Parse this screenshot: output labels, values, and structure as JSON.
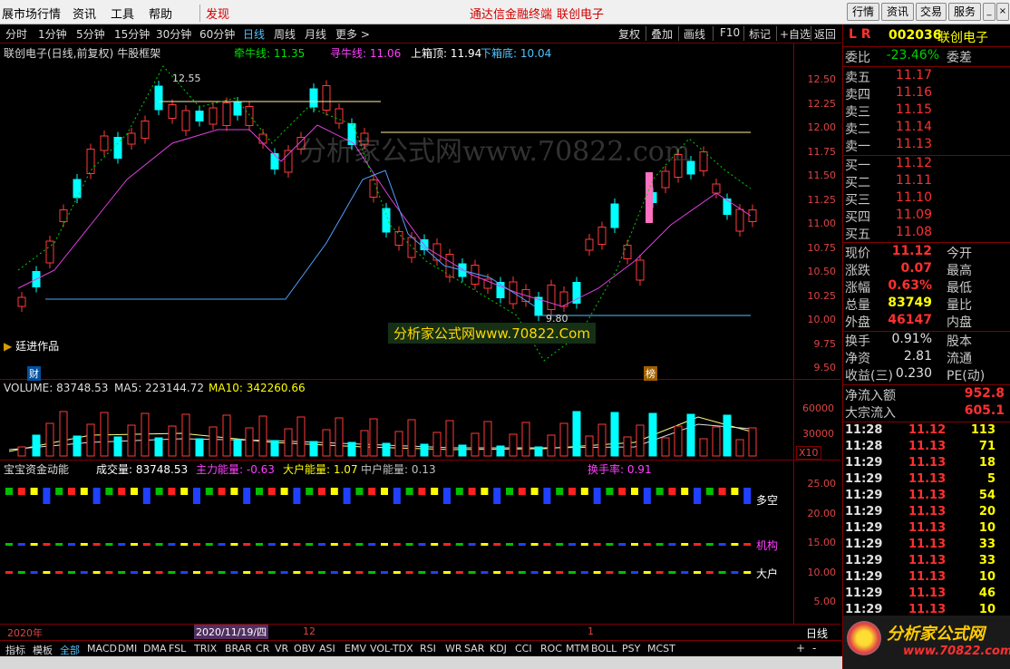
{
  "menu": {
    "items": [
      "展市场行情",
      "资讯",
      "工具",
      "帮助",
      "发现"
    ],
    "center_links": [
      "通达信金融终端",
      "联创电子"
    ],
    "right_buttons": [
      "行情",
      "资讯",
      "交易",
      "服务"
    ]
  },
  "periods": [
    "分时",
    "1分钟",
    "5分钟",
    "15分钟",
    "30分钟",
    "60分钟",
    "日线",
    "周线",
    "月线",
    "更多 >"
  ],
  "tools": [
    "复权",
    "叠加",
    "画线",
    "F10",
    "标记",
    "+自选",
    "返回"
  ],
  "main_chart": {
    "title": "联创电子(日线,前复权)",
    "indicator_name": "牛股框架",
    "lines": [
      {
        "label": "牵牛线: 11.35",
        "color": "#00e000"
      },
      {
        "label": "寻牛线: 11.06",
        "color": "#ff40ff"
      },
      {
        "label": "上箱顶: 11.94",
        "color": "#ffffff"
      },
      {
        "label": "下箱底: 10.04",
        "color": "#4fc3ff"
      }
    ],
    "yaxis": [
      "12.50",
      "12.25",
      "12.00",
      "11.75",
      "11.50",
      "11.25",
      "11.00",
      "10.75",
      "10.50",
      "10.25",
      "10.00",
      "9.75",
      "9.50"
    ],
    "high_label": "12.55",
    "low_label": "9.80",
    "author_label": "廷进作品",
    "watermark": "分析家公式网www.70822.com",
    "banner": "分析家公式网www.70822.Com",
    "markers": [
      "财",
      "榜"
    ]
  },
  "volume_chart": {
    "title": "VOLUME: 83748.53",
    "ma5": "MA5: 223144.72",
    "ma10": "MA10: 342260.66",
    "yaxis": [
      "60000",
      "30000"
    ],
    "unit": "X10"
  },
  "money_chart": {
    "title": "宝宝资金动能",
    "items": [
      {
        "label": "成交量: 83748.53",
        "color": "#ffffff"
      },
      {
        "label": "主力能量: -0.63",
        "color": "#ff40ff"
      },
      {
        "label": "大户能量: 1.07",
        "color": "#ffff00"
      },
      {
        "label": "中户能量: 0.13",
        "color": "#c0c0c0"
      },
      {
        "label": "换手率: 0.91",
        "color": "#ff40ff"
      }
    ],
    "yaxis": [
      "25.00",
      "20.00",
      "15.00",
      "10.00",
      "5.00"
    ],
    "row_labels": [
      "多空",
      "机构",
      "大户"
    ]
  },
  "time_axis": {
    "labels": [
      "2020年",
      "2020/11/19/四",
      "12",
      "1"
    ],
    "period_label": "日线"
  },
  "bottom_tabs": [
    "指标",
    "模板",
    "全部",
    "MACD",
    "DMI",
    "DMA",
    "FSL",
    "TRIX",
    "BRAR",
    "CR",
    "VR",
    "OBV",
    "ASI",
    "EMV",
    "VOL-TDX",
    "RSI",
    "WR",
    "SAR",
    "KDJ",
    "CCI",
    "ROC",
    "MTM",
    "BOLL",
    "PSY",
    "MCST"
  ],
  "stock": {
    "code": "002036",
    "name": "联创电子",
    "flags": "L R"
  },
  "order_book": {
    "ratio_label": "委比",
    "ratio": "-23.46%",
    "diff_label": "委差",
    "asks": [
      {
        "label": "卖五",
        "price": "11.17"
      },
      {
        "label": "卖四",
        "price": "11.16"
      },
      {
        "label": "卖三",
        "price": "11.15"
      },
      {
        "label": "卖二",
        "price": "11.14"
      },
      {
        "label": "卖一",
        "price": "11.13"
      }
    ],
    "bids": [
      {
        "label": "买一",
        "price": "11.12"
      },
      {
        "label": "买二",
        "price": "11.11"
      },
      {
        "label": "买三",
        "price": "11.10"
      },
      {
        "label": "买四",
        "price": "11.09"
      },
      {
        "label": "买五",
        "price": "11.08"
      }
    ]
  },
  "quote": [
    {
      "label": "现价",
      "value": "11.12",
      "label2": "今开",
      "color": "#ff3030"
    },
    {
      "label": "涨跌",
      "value": "0.07",
      "label2": "最高",
      "color": "#ff3030"
    },
    {
      "label": "涨幅",
      "value": "0.63%",
      "label2": "最低",
      "color": "#ff3030"
    },
    {
      "label": "总量",
      "value": "83749",
      "label2": "量比",
      "color": "#ffff00"
    },
    {
      "label": "外盘",
      "value": "46147",
      "label2": "内盘",
      "color": "#ff3030"
    }
  ],
  "fundamentals": [
    {
      "label": "换手",
      "value": "0.91%",
      "label2": "股本"
    },
    {
      "label": "净资",
      "value": "2.81",
      "label2": "流通"
    },
    {
      "label": "收益(三)",
      "value": "0.230",
      "label2": "PE(动)"
    }
  ],
  "flows": [
    {
      "label": "净流入额",
      "value": "952.8"
    },
    {
      "label": "大宗流入",
      "value": "605.1"
    }
  ],
  "ticks": [
    {
      "time": "11:28",
      "price": "11.12",
      "vol": "113"
    },
    {
      "time": "11:28",
      "price": "11.13",
      "vol": "71"
    },
    {
      "time": "11:29",
      "price": "11.13",
      "vol": "18"
    },
    {
      "time": "11:29",
      "price": "11.13",
      "vol": "5"
    },
    {
      "time": "11:29",
      "price": "11.13",
      "vol": "54"
    },
    {
      "time": "11:29",
      "price": "11.13",
      "vol": "20"
    },
    {
      "time": "11:29",
      "price": "11.13",
      "vol": "10"
    },
    {
      "time": "11:29",
      "price": "11.13",
      "vol": "33"
    },
    {
      "time": "11:29",
      "price": "11.13",
      "vol": "33"
    },
    {
      "time": "11:29",
      "price": "11.13",
      "vol": "10"
    },
    {
      "time": "11:29",
      "price": "11.13",
      "vol": "46"
    },
    {
      "time": "11:29",
      "price": "11.13",
      "vol": "10"
    }
  ],
  "logo": {
    "text": "分析家公式网",
    "url": "www.70822.com"
  }
}
